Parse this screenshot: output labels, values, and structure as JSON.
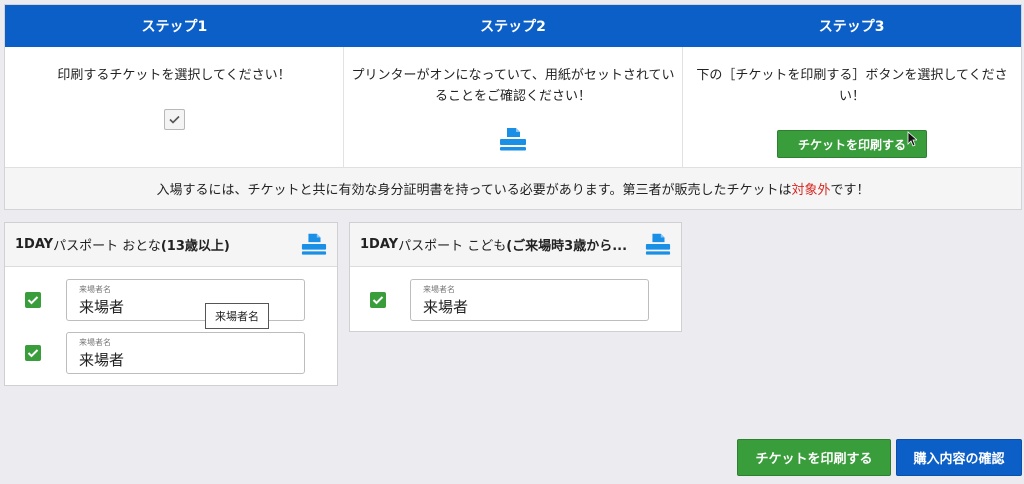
{
  "steps": {
    "headers": [
      "ステップ1",
      "ステップ2",
      "ステップ3"
    ],
    "step1_text": "印刷するチケットを選択してください！",
    "step2_text": "プリンターがオンになっていて、用紙がセットされていることをご確認ください！",
    "step3_text": "下の［チケットを印刷する］ボタンを選択してください！",
    "step3_button": "チケットを印刷する"
  },
  "notice": {
    "text_before": "入場するには、チケットと共に有効な身分証明書を持っている必要があります。第三者が販売したチケットは",
    "highlight": "対象外",
    "text_after": "です！",
    "highlight_color": "#d7261f"
  },
  "cards": [
    {
      "title_bold": "1DAY",
      "title_light": "パスポート おとな",
      "title_tail": " (13歳以上)",
      "rows": [
        {
          "label": "来場者名",
          "value": "来場者",
          "checked": true
        },
        {
          "label": "来場者名",
          "value": "来場者",
          "checked": true
        }
      ]
    },
    {
      "title_bold": "1DAY",
      "title_light": "パスポート こども",
      "title_tail": " (ご来場時3歳から...",
      "rows": [
        {
          "label": "来場者名",
          "value": "来場者",
          "checked": true
        }
      ]
    }
  ],
  "tooltip": "来場者名",
  "buttons": {
    "print": "チケットを印刷する",
    "confirm": "購入内容の確認"
  },
  "colors": {
    "header_blue": "#0d5fc8",
    "button_green": "#3a9d3c",
    "icon_blue": "#1a8fe6"
  },
  "icons": [
    "checkbox-icon",
    "printer-icon",
    "check-icon",
    "cursor-icon"
  ]
}
